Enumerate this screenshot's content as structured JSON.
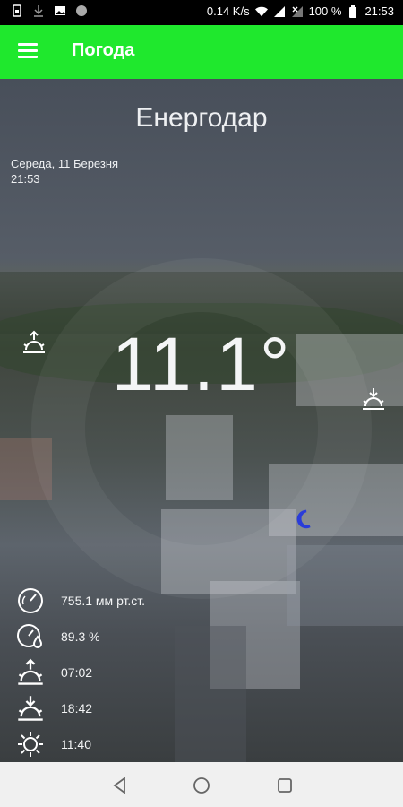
{
  "status_bar": {
    "speed": "0.14 K/s",
    "battery": "100 %",
    "clock": "21:53",
    "icons": [
      "sim-icon",
      "download-icon",
      "image-icon",
      "circle-icon",
      "wifi-icon",
      "signal-icon",
      "no-signal-icon",
      "battery-icon"
    ]
  },
  "app_bar": {
    "title": "Погода",
    "menu_icon": "hamburger-menu-icon"
  },
  "weather": {
    "city": "Енергодар",
    "date": "Середа, 11 Березня",
    "time": "21:53",
    "temperature": "11.1°",
    "sunrise_marker_icon": "sunrise-icon",
    "sunset_marker_icon": "sunset-icon",
    "moon_icon": "moon-icon",
    "moon_color": "#2a3cd9"
  },
  "details": [
    {
      "icon": "pressure-gauge-icon",
      "value": "755.1 мм рт.ст."
    },
    {
      "icon": "humidity-icon",
      "value": "89.3 %"
    },
    {
      "icon": "sunrise-icon",
      "value": "07:02"
    },
    {
      "icon": "sunset-icon",
      "value": "18:42"
    },
    {
      "icon": "sun-icon",
      "value": "11:40"
    }
  ],
  "nav_bar": {
    "back_icon": "back-triangle-icon",
    "home_icon": "home-circle-icon",
    "recents_icon": "recents-square-icon"
  },
  "colors": {
    "app_bar": "#1fe82d",
    "status_bar": "#000000",
    "nav_bar": "#f0f0f0"
  }
}
